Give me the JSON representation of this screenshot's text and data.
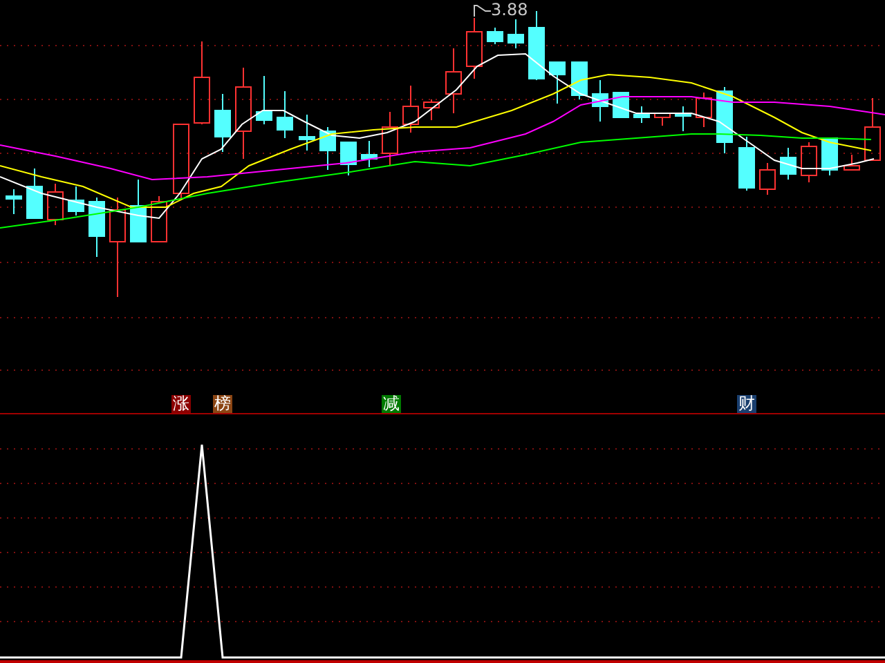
{
  "price_panel": {
    "high_price_label": "3.88"
  },
  "signals": [
    {
      "text": "涨",
      "color": "#8b0000"
    },
    {
      "text": "榜",
      "color": "#8b4513"
    },
    {
      "text": "减",
      "color": "#007a00"
    },
    {
      "text": "财",
      "color": "#1a3f6f"
    }
  ]
}
